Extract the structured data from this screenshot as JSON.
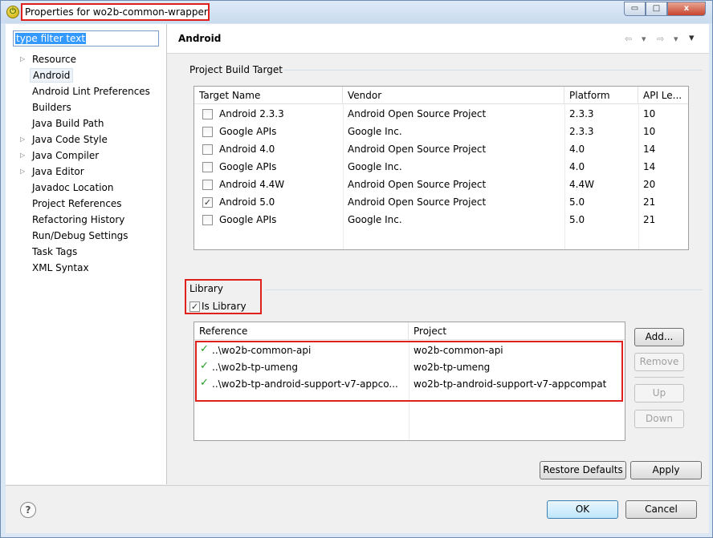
{
  "window": {
    "title": "Properties for wo2b-common-wrapper",
    "app_icon": "eclipse-icon",
    "min_glyph": "▭",
    "max_glyph": "□",
    "close_glyph": "x"
  },
  "filter": {
    "text": "type filter text"
  },
  "tree": {
    "items": [
      {
        "label": "Resource",
        "expandable": true
      },
      {
        "label": "Android",
        "selected": true
      },
      {
        "label": "Android Lint Preferences"
      },
      {
        "label": "Builders"
      },
      {
        "label": "Java Build Path"
      },
      {
        "label": "Java Code Style",
        "expandable": true
      },
      {
        "label": "Java Compiler",
        "expandable": true
      },
      {
        "label": "Java Editor",
        "expandable": true
      },
      {
        "label": "Javadoc Location"
      },
      {
        "label": "Project References"
      },
      {
        "label": "Refactoring History"
      },
      {
        "label": "Run/Debug Settings"
      },
      {
        "label": "Task Tags"
      },
      {
        "label": "XML Syntax"
      }
    ]
  },
  "page": {
    "title": "Android",
    "nav": {
      "back": "⇦",
      "back_menu": "▾",
      "forward": "⇨",
      "forward_menu": "▾",
      "view_menu": "▾"
    }
  },
  "build_target": {
    "group_label": "Project Build Target",
    "columns": [
      "Target Name",
      "Vendor",
      "Platform",
      "API Le..."
    ],
    "rows": [
      {
        "name": "Android 2.3.3",
        "vendor": "Android Open Source Project",
        "platform": "2.3.3",
        "api": "10",
        "checked": false
      },
      {
        "name": "Google APIs",
        "vendor": "Google Inc.",
        "platform": "2.3.3",
        "api": "10",
        "checked": false
      },
      {
        "name": "Android 4.0",
        "vendor": "Android Open Source Project",
        "platform": "4.0",
        "api": "14",
        "checked": false
      },
      {
        "name": "Google APIs",
        "vendor": "Google Inc.",
        "platform": "4.0",
        "api": "14",
        "checked": false
      },
      {
        "name": "Android 4.4W",
        "vendor": "Android Open Source Project",
        "platform": "4.4W",
        "api": "20",
        "checked": false
      },
      {
        "name": "Android 5.0",
        "vendor": "Android Open Source Project",
        "platform": "5.0",
        "api": "21",
        "checked": true
      },
      {
        "name": "Google APIs",
        "vendor": "Google Inc.",
        "platform": "5.0",
        "api": "21",
        "checked": false
      }
    ]
  },
  "library": {
    "group_label": "Library",
    "is_library_label": "Is Library",
    "is_library_checked": true,
    "check_glyph": "✓",
    "columns": [
      "Reference",
      "Project"
    ],
    "rows": [
      {
        "reference": "..\\wo2b-common-api",
        "project": "wo2b-common-api"
      },
      {
        "reference": "..\\wo2b-tp-umeng",
        "project": "wo2b-tp-umeng"
      },
      {
        "reference": "..\\wo2b-tp-android-support-v7-appco...",
        "project": "wo2b-tp-android-support-v7-appcompat"
      }
    ],
    "buttons": {
      "add": "Add...",
      "remove": "Remove",
      "up": "Up",
      "down": "Down"
    }
  },
  "actions": {
    "restore_defaults": "Restore Defaults",
    "apply": "Apply",
    "ok": "OK",
    "cancel": "Cancel",
    "help": "?"
  },
  "colors": {
    "highlight_red": "#e0201c",
    "selection_blue": "#3399ff",
    "ok_green": "#1f9d1f"
  }
}
